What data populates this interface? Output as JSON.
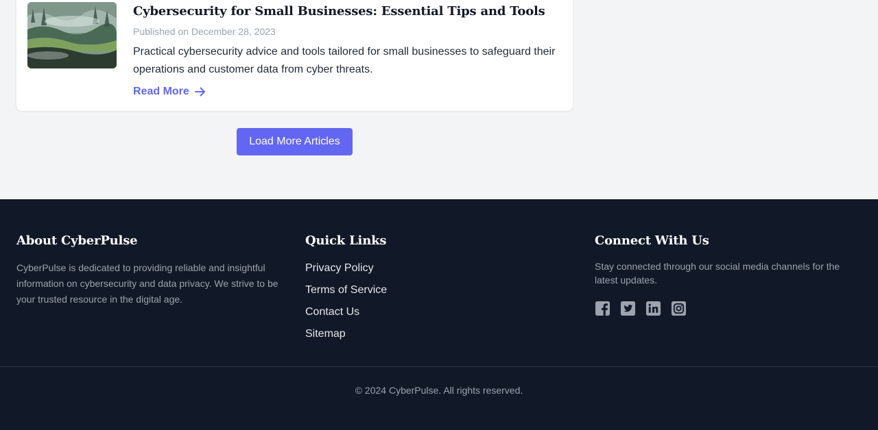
{
  "article": {
    "thumbnail_icon": "landscape-image",
    "title": "Cybersecurity for Small Businesses: Essential Tips and Tools",
    "date": "Published on December 28, 2023",
    "description": "Practical cybersecurity advice and tools tailored for small businesses to safeguard their operations and customer data from cyber threats.",
    "read_more_label": "Read More",
    "read_more_icon": "arrow-right-icon"
  },
  "load_more_label": "Load More Articles",
  "footer": {
    "about": {
      "heading": "About CyberPulse",
      "text": "CyberPulse is dedicated to providing reliable and insightful information on cybersecurity and data privacy. We strive to be your trusted resource in the digital age."
    },
    "quick_links": {
      "heading": "Quick Links",
      "items": [
        "Privacy Policy",
        "Terms of Service",
        "Contact Us",
        "Sitemap"
      ]
    },
    "connect": {
      "heading": "Connect With Us",
      "text": "Stay connected through our social media channels for the latest updates.",
      "socials": [
        "facebook-icon",
        "twitter-icon",
        "linkedin-icon",
        "instagram-icon"
      ]
    },
    "copyright": "© 2024 CyberPulse. All rights reserved."
  },
  "colors": {
    "accent": "#6366f1",
    "footer_bg": "#111827",
    "page_bg": "#f3f4f6"
  }
}
